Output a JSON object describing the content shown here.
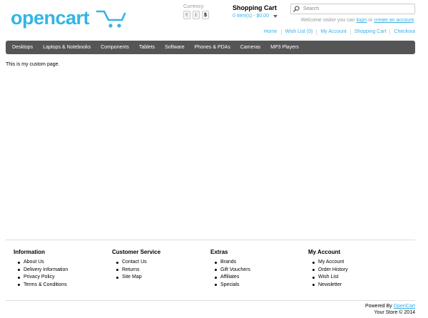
{
  "logo": {
    "text": "opencart"
  },
  "currency": {
    "label": "Currency",
    "options": [
      "€",
      "£",
      "$"
    ]
  },
  "cart": {
    "title": "Shopping Cart",
    "total": "0 item(s) - $0.00"
  },
  "search": {
    "placeholder": "Search"
  },
  "welcome": {
    "prefix": "Welcome visitor you can",
    "login": "login",
    "or": "or",
    "create": "create an account",
    "suffix": "."
  },
  "links": [
    "Home",
    "Wish List (0)",
    "My Account",
    "Shopping Cart",
    "Checkout"
  ],
  "menu": [
    "Desktops",
    "Laptops & Notebooks",
    "Components",
    "Tablets",
    "Software",
    "Phones & PDAs",
    "Cameras",
    "MP3 Players"
  ],
  "content": {
    "text": "This is my custom page."
  },
  "footer": {
    "columns": [
      {
        "title": "Information",
        "items": [
          "About Us",
          "Delivery Information",
          "Privacy Policy",
          "Terms & Conditions"
        ]
      },
      {
        "title": "Customer Service",
        "items": [
          "Contact Us",
          "Returns",
          "Site Map"
        ]
      },
      {
        "title": "Extras",
        "items": [
          "Brands",
          "Gift Vouchers",
          "Affiliates",
          "Specials"
        ]
      },
      {
        "title": "My Account",
        "items": [
          "My Account",
          "Order History",
          "Wish List",
          "Newsletter"
        ]
      }
    ]
  },
  "powered": {
    "prefix": "Powered By",
    "link": "OpenCart",
    "copyright": "Your Store © 2014"
  },
  "colors": {
    "link": "#38b0e3",
    "menu_bg": "#555555",
    "logo_blue": "#33b5e5"
  }
}
